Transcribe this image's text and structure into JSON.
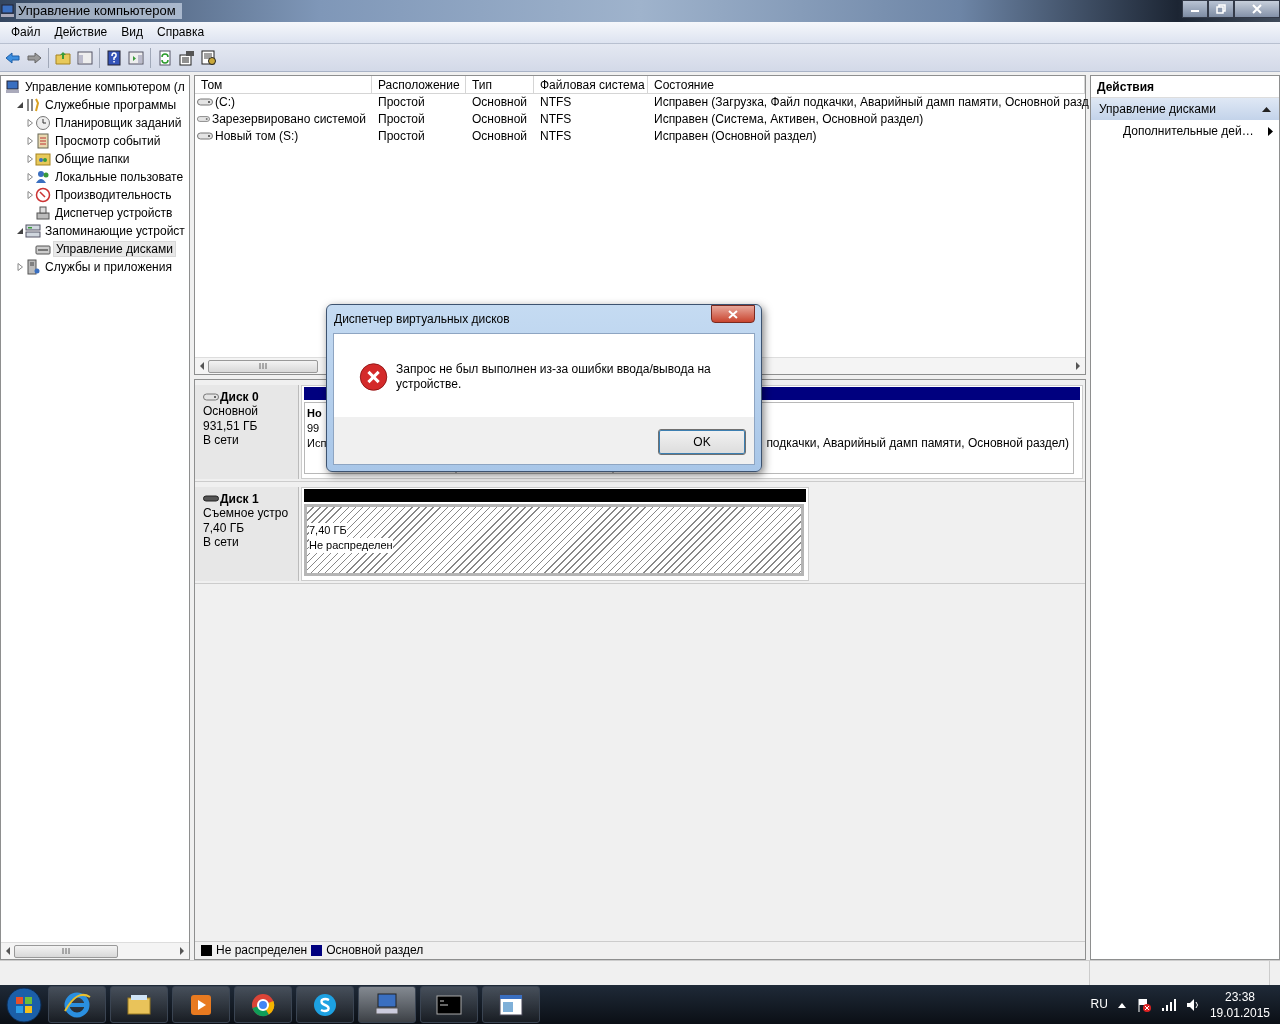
{
  "window": {
    "title": "Управление компьютером"
  },
  "menu": [
    "Файл",
    "Действие",
    "Вид",
    "Справка"
  ],
  "tree": [
    {
      "label": "Управление компьютером (л",
      "selected": false,
      "children": [
        {
          "label": "Служебные программы",
          "expanded": true,
          "selected": false,
          "children": [
            {
              "label": "Планировщик заданий",
              "expanded": false,
              "selected": false
            },
            {
              "label": "Просмотр событий",
              "expanded": false,
              "selected": false
            },
            {
              "label": "Общие папки",
              "expanded": false,
              "selected": false
            },
            {
              "label": "Локальные пользовате",
              "expanded": false,
              "selected": false
            },
            {
              "label": "Производительность",
              "expanded": false,
              "selected": false
            },
            {
              "label": "Диспетчер устройств",
              "selected": false
            }
          ]
        },
        {
          "label": "Запоминающие устройст",
          "expanded": true,
          "selected": false,
          "children": [
            {
              "label": "Управление дисками",
              "selected": true
            }
          ]
        },
        {
          "label": "Службы и приложения",
          "expanded": false,
          "selected": false
        }
      ]
    }
  ],
  "volumes": {
    "columns": [
      "Том",
      "Расположение",
      "Тип",
      "Файловая система",
      "Состояние"
    ],
    "rows": [
      [
        "(C:)",
        "Простой",
        "Основной",
        "NTFS",
        "Исправен (Загрузка, Файл подкачки, Аварийный дамп памяти, Основной разд"
      ],
      [
        "Зарезервировано системой",
        "Простой",
        "Основной",
        "NTFS",
        "Исправен (Система, Активен, Основной раздел)"
      ],
      [
        "Новый том (S:)",
        "Простой",
        "Основной",
        "NTFS",
        "Исправен (Основной раздел)"
      ]
    ]
  },
  "disks": [
    {
      "title": "Диск 0",
      "type": "Основной",
      "size": "931,51 ГБ",
      "status": "В сети",
      "partitions": [
        {
          "kind": "primary",
          "name": "Но",
          "size": "99",
          "status": "Исп"
        },
        {
          "kind": "primary"
        },
        {
          "kind": "primary",
          "status": "подкачки, Аварийный дамп памяти, Основной раздел)"
        }
      ]
    },
    {
      "title": "Диск 1",
      "type": "Съемное устро",
      "size": "7,40 ГБ",
      "status": "В сети",
      "partitions": [
        {
          "kind": "unallocated",
          "size": "7,40 ГБ",
          "status": "Не распределен"
        }
      ]
    }
  ],
  "legend": [
    {
      "label": "Не распределен",
      "color": "#000000"
    },
    {
      "label": "Основной раздел",
      "color": "#00007f"
    }
  ],
  "actions": {
    "title": "Действия",
    "section": "Управление дисками",
    "items": [
      "Дополнительные дей…"
    ]
  },
  "dialog": {
    "title": "Диспетчер виртуальных дисков",
    "message": "Запрос не был выполнен из-за ошибки ввода/вывода на устройстве.",
    "buttons": [
      "OK"
    ]
  },
  "taskbar": {
    "language": "RU",
    "time": "23:38",
    "date": "19.01.2015"
  }
}
